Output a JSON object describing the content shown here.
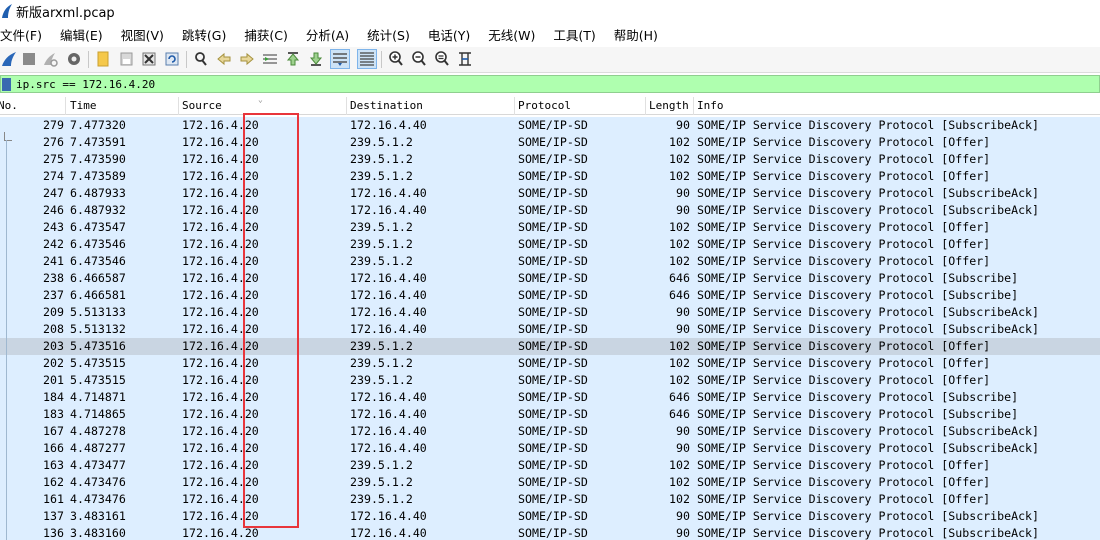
{
  "window": {
    "title": "新版arxml.pcap",
    "app_icon": "wireshark-fin-icon"
  },
  "menu": [
    "文件(F)",
    "编辑(E)",
    "视图(V)",
    "跳转(G)",
    "捕获(C)",
    "分析(A)",
    "统计(S)",
    "电话(Y)",
    "无线(W)",
    "工具(T)",
    "帮助(H)"
  ],
  "toolbar": {
    "icons": [
      "start-capture-icon",
      "stop-capture-icon",
      "restart-capture-icon",
      "capture-options-icon",
      "open-file-icon",
      "save-file-icon",
      "close-file-icon",
      "reload-file-icon",
      "find-packet-icon",
      "go-back-icon",
      "go-forward-icon",
      "go-to-packet-icon",
      "go-first-packet-icon",
      "go-last-packet-icon",
      "auto-scroll-icon",
      "colorize-icon",
      "zoom-in-icon",
      "zoom-out-icon",
      "normal-size-icon",
      "resize-columns-icon"
    ]
  },
  "filter": {
    "expression": "ip.src == 172.16.4.20",
    "color": "#afffaf"
  },
  "columns": {
    "no": "No.",
    "time": "Time",
    "source": "Source",
    "destination": "Destination",
    "protocol": "Protocol",
    "length": "Length",
    "info": "Info"
  },
  "packets": [
    {
      "no": "279",
      "time": "7.477320",
      "src": "172.16.4.20",
      "dst": "172.16.4.40",
      "proto": "SOME/IP-SD",
      "len": "90",
      "info": "SOME/IP Service Discovery Protocol [SubscribeAck]"
    },
    {
      "no": "276",
      "time": "7.473591",
      "src": "172.16.4.20",
      "dst": "239.5.1.2",
      "proto": "SOME/IP-SD",
      "len": "102",
      "info": "SOME/IP Service Discovery Protocol [Offer]"
    },
    {
      "no": "275",
      "time": "7.473590",
      "src": "172.16.4.20",
      "dst": "239.5.1.2",
      "proto": "SOME/IP-SD",
      "len": "102",
      "info": "SOME/IP Service Discovery Protocol [Offer]"
    },
    {
      "no": "274",
      "time": "7.473589",
      "src": "172.16.4.20",
      "dst": "239.5.1.2",
      "proto": "SOME/IP-SD",
      "len": "102",
      "info": "SOME/IP Service Discovery Protocol [Offer]"
    },
    {
      "no": "247",
      "time": "6.487933",
      "src": "172.16.4.20",
      "dst": "172.16.4.40",
      "proto": "SOME/IP-SD",
      "len": "90",
      "info": "SOME/IP Service Discovery Protocol [SubscribeAck]"
    },
    {
      "no": "246",
      "time": "6.487932",
      "src": "172.16.4.20",
      "dst": "172.16.4.40",
      "proto": "SOME/IP-SD",
      "len": "90",
      "info": "SOME/IP Service Discovery Protocol [SubscribeAck]"
    },
    {
      "no": "243",
      "time": "6.473547",
      "src": "172.16.4.20",
      "dst": "239.5.1.2",
      "proto": "SOME/IP-SD",
      "len": "102",
      "info": "SOME/IP Service Discovery Protocol [Offer]"
    },
    {
      "no": "242",
      "time": "6.473546",
      "src": "172.16.4.20",
      "dst": "239.5.1.2",
      "proto": "SOME/IP-SD",
      "len": "102",
      "info": "SOME/IP Service Discovery Protocol [Offer]"
    },
    {
      "no": "241",
      "time": "6.473546",
      "src": "172.16.4.20",
      "dst": "239.5.1.2",
      "proto": "SOME/IP-SD",
      "len": "102",
      "info": "SOME/IP Service Discovery Protocol [Offer]"
    },
    {
      "no": "238",
      "time": "6.466587",
      "src": "172.16.4.20",
      "dst": "172.16.4.40",
      "proto": "SOME/IP-SD",
      "len": "646",
      "info": "SOME/IP Service Discovery Protocol [Subscribe]"
    },
    {
      "no": "237",
      "time": "6.466581",
      "src": "172.16.4.20",
      "dst": "172.16.4.40",
      "proto": "SOME/IP-SD",
      "len": "646",
      "info": "SOME/IP Service Discovery Protocol [Subscribe]"
    },
    {
      "no": "209",
      "time": "5.513133",
      "src": "172.16.4.20",
      "dst": "172.16.4.40",
      "proto": "SOME/IP-SD",
      "len": "90",
      "info": "SOME/IP Service Discovery Protocol [SubscribeAck]"
    },
    {
      "no": "208",
      "time": "5.513132",
      "src": "172.16.4.20",
      "dst": "172.16.4.40",
      "proto": "SOME/IP-SD",
      "len": "90",
      "info": "SOME/IP Service Discovery Protocol [SubscribeAck]"
    },
    {
      "no": "203",
      "time": "5.473516",
      "src": "172.16.4.20",
      "dst": "239.5.1.2",
      "proto": "SOME/IP-SD",
      "len": "102",
      "info": "SOME/IP Service Discovery Protocol [Offer]",
      "selected": true
    },
    {
      "no": "202",
      "time": "5.473515",
      "src": "172.16.4.20",
      "dst": "239.5.1.2",
      "proto": "SOME/IP-SD",
      "len": "102",
      "info": "SOME/IP Service Discovery Protocol [Offer]"
    },
    {
      "no": "201",
      "time": "5.473515",
      "src": "172.16.4.20",
      "dst": "239.5.1.2",
      "proto": "SOME/IP-SD",
      "len": "102",
      "info": "SOME/IP Service Discovery Protocol [Offer]"
    },
    {
      "no": "184",
      "time": "4.714871",
      "src": "172.16.4.20",
      "dst": "172.16.4.40",
      "proto": "SOME/IP-SD",
      "len": "646",
      "info": "SOME/IP Service Discovery Protocol [Subscribe]"
    },
    {
      "no": "183",
      "time": "4.714865",
      "src": "172.16.4.20",
      "dst": "172.16.4.40",
      "proto": "SOME/IP-SD",
      "len": "646",
      "info": "SOME/IP Service Discovery Protocol [Subscribe]"
    },
    {
      "no": "167",
      "time": "4.487278",
      "src": "172.16.4.20",
      "dst": "172.16.4.40",
      "proto": "SOME/IP-SD",
      "len": "90",
      "info": "SOME/IP Service Discovery Protocol [SubscribeAck]"
    },
    {
      "no": "166",
      "time": "4.487277",
      "src": "172.16.4.20",
      "dst": "172.16.4.40",
      "proto": "SOME/IP-SD",
      "len": "90",
      "info": "SOME/IP Service Discovery Protocol [SubscribeAck]"
    },
    {
      "no": "163",
      "time": "4.473477",
      "src": "172.16.4.20",
      "dst": "239.5.1.2",
      "proto": "SOME/IP-SD",
      "len": "102",
      "info": "SOME/IP Service Discovery Protocol [Offer]"
    },
    {
      "no": "162",
      "time": "4.473476",
      "src": "172.16.4.20",
      "dst": "239.5.1.2",
      "proto": "SOME/IP-SD",
      "len": "102",
      "info": "SOME/IP Service Discovery Protocol [Offer]"
    },
    {
      "no": "161",
      "time": "4.473476",
      "src": "172.16.4.20",
      "dst": "239.5.1.2",
      "proto": "SOME/IP-SD",
      "len": "102",
      "info": "SOME/IP Service Discovery Protocol [Offer]"
    },
    {
      "no": "137",
      "time": "3.483161",
      "src": "172.16.4.20",
      "dst": "172.16.4.40",
      "proto": "SOME/IP-SD",
      "len": "90",
      "info": "SOME/IP Service Discovery Protocol [SubscribeAck]"
    },
    {
      "no": "136",
      "time": "3.483160",
      "src": "172.16.4.20",
      "dst": "172.16.4.40",
      "proto": "SOME/IP-SD",
      "len": "90",
      "info": "SOME/IP Service Discovery Protocol [SubscribeAck]"
    }
  ],
  "colors": {
    "row_bg": "#ddeeff",
    "selected_row_bg": "#c9d5e2",
    "annotation_box": "#e8353b"
  }
}
